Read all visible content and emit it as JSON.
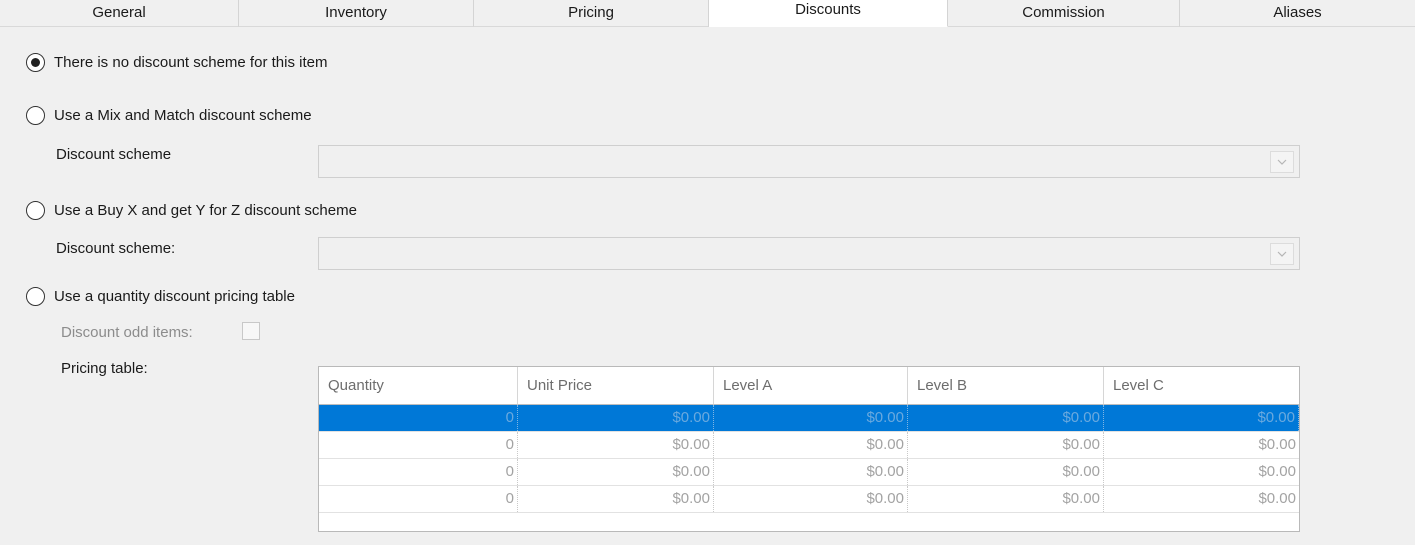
{
  "tabs": [
    {
      "label": "General"
    },
    {
      "label": "Inventory"
    },
    {
      "label": "Pricing"
    },
    {
      "label": "Discounts",
      "active": true
    },
    {
      "label": "Commission"
    },
    {
      "label": "Aliases"
    }
  ],
  "options": {
    "no_scheme": "There is no discount scheme for this item",
    "mix_match": "Use a Mix and Match discount scheme",
    "buy_x_get_y": "Use a Buy X and get Y for Z discount scheme",
    "quantity_table": "Use a quantity discount pricing table",
    "selected": "no_scheme"
  },
  "labels": {
    "mix_match_scheme": "Discount scheme",
    "buy_x_scheme": "Discount scheme:",
    "discount_odd_items": "Discount odd items:",
    "pricing_table": "Pricing table:"
  },
  "combos": {
    "mix_match_value": "",
    "buy_x_value": ""
  },
  "discount_odd_items_checked": false,
  "pricing_table": {
    "columns": [
      "Quantity",
      "Unit Price",
      "Level A",
      "Level B",
      "Level C"
    ],
    "rows": [
      [
        "0",
        "$0.00",
        "$0.00",
        "$0.00",
        "$0.00"
      ],
      [
        "0",
        "$0.00",
        "$0.00",
        "$0.00",
        "$0.00"
      ],
      [
        "0",
        "$0.00",
        "$0.00",
        "$0.00",
        "$0.00"
      ],
      [
        "0",
        "$0.00",
        "$0.00",
        "$0.00",
        "$0.00"
      ]
    ],
    "selected_row": 0
  },
  "colors": {
    "selection": "#0078d7",
    "background": "#f0f0f0"
  }
}
